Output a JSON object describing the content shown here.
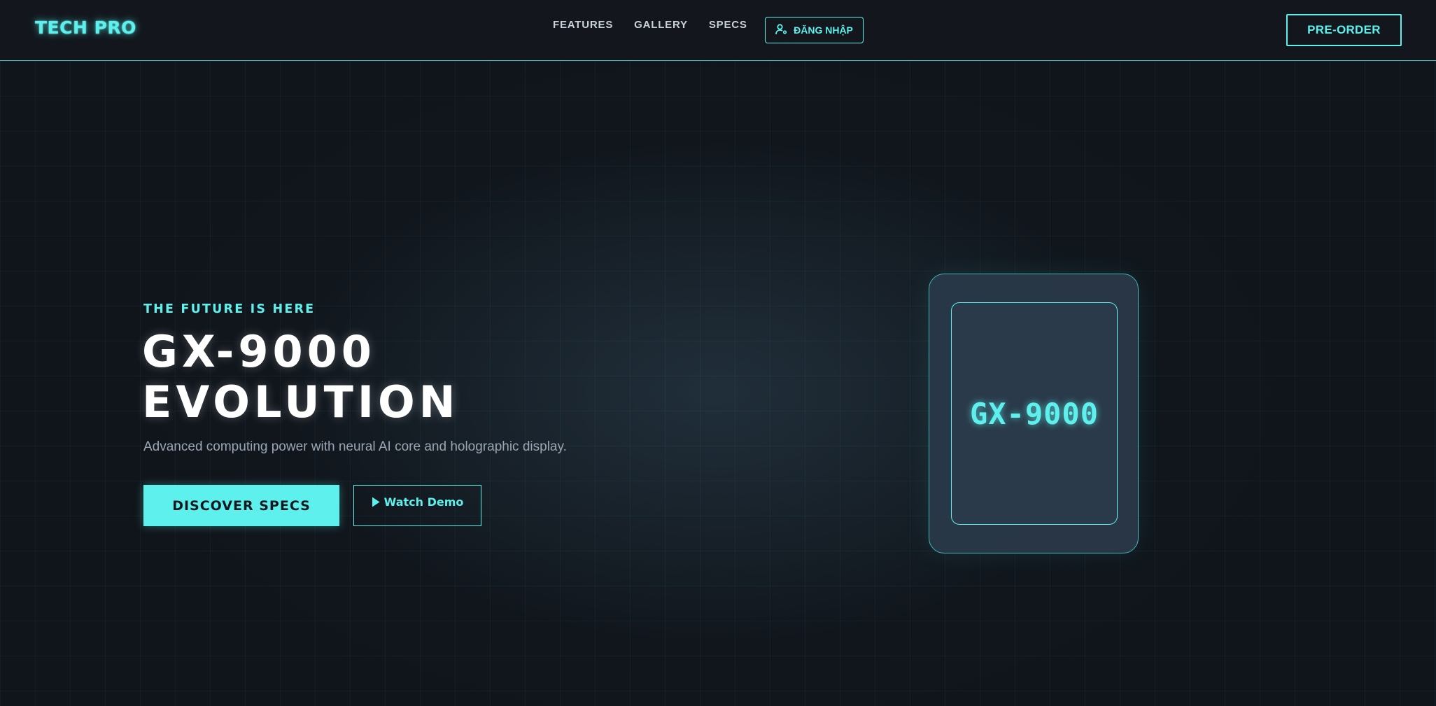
{
  "header": {
    "logo": "TECH PRO",
    "nav": [
      "FEATURES",
      "GALLERY",
      "SPECS"
    ],
    "login_label": "ĐĂNG NHẬP",
    "preorder_label": "PRE-ORDER"
  },
  "hero": {
    "eyebrow": "THE FUTURE IS HERE",
    "title_line1": "GX-9000",
    "title_line2": "EVOLUTION",
    "description": "Advanced computing power with neural AI core and holographic display.",
    "discover_label": "DISCOVER SPECS",
    "demo_label": "Watch Demo"
  },
  "device": {
    "label": "GX-9000"
  },
  "colors": {
    "accent": "#5ef0ec",
    "background": "#10151b",
    "header": "#13171d",
    "device_body": "#2a3a4a"
  },
  "icons": {
    "login": "user-settings-icon",
    "demo": "play-icon"
  }
}
